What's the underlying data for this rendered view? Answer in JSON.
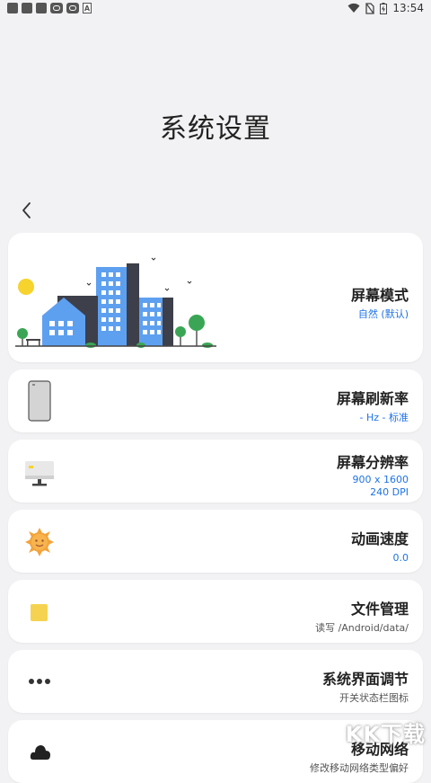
{
  "status": {
    "time": "13:54"
  },
  "page": {
    "title": "系统设置"
  },
  "items": [
    {
      "name": "屏幕模式",
      "value": "自然 (默认)"
    },
    {
      "name": "屏幕刷新率",
      "value": "- Hz - 标准"
    },
    {
      "name": "屏幕分辨率",
      "value": "900 x 1600",
      "value2": "240 DPI"
    },
    {
      "name": "动画速度",
      "value": "0.0"
    },
    {
      "name": "文件管理",
      "value": "读写 /Android/data/"
    },
    {
      "name": "系统界面调节",
      "value": "开关状态栏图标"
    },
    {
      "name": "移动网络",
      "value": "修改移动网络类型偏好"
    }
  ],
  "watermark": "KK下载",
  "colors": {
    "accent": "#1e73e6",
    "background": "#f2f2f4",
    "card": "#ffffff"
  }
}
